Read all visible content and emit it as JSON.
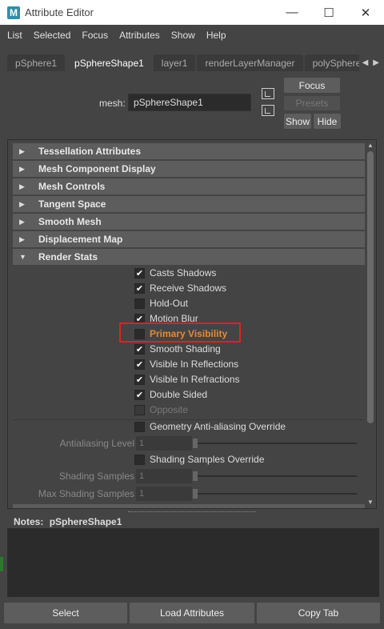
{
  "window": {
    "title": "Attribute Editor",
    "app_icon_letter": "M"
  },
  "window_controls": {
    "minimize": "—",
    "maximize": "☐",
    "close": "✕"
  },
  "menu": [
    "List",
    "Selected",
    "Focus",
    "Attributes",
    "Show",
    "Help"
  ],
  "tabs": [
    "pSphere1",
    "pSphereShape1",
    "layer1",
    "renderLayerManager",
    "polySphere"
  ],
  "active_tab": "pSphereShape1",
  "mesh": {
    "label": "mesh:",
    "value": "pSphereShape1"
  },
  "buttons": {
    "focus": "Focus",
    "presets": "Presets",
    "show": "Show",
    "hide": "Hide"
  },
  "sections": [
    {
      "label": "Tessellation Attributes",
      "expanded": false
    },
    {
      "label": "Mesh Component Display",
      "expanded": false
    },
    {
      "label": "Mesh Controls",
      "expanded": false
    },
    {
      "label": "Tangent Space",
      "expanded": false
    },
    {
      "label": "Smooth Mesh",
      "expanded": false
    },
    {
      "label": "Displacement Map",
      "expanded": false
    },
    {
      "label": "Render Stats",
      "expanded": true
    }
  ],
  "render_stats": [
    {
      "label": "Casts Shadows",
      "checked": true
    },
    {
      "label": "Receive Shadows",
      "checked": true
    },
    {
      "label": "Hold-Out",
      "checked": false
    },
    {
      "label": "Motion Blur",
      "checked": true
    },
    {
      "label": "Primary Visibility",
      "checked": false,
      "highlighted": true
    },
    {
      "label": "Smooth Shading",
      "checked": true
    },
    {
      "label": "Visible In Reflections",
      "checked": true
    },
    {
      "label": "Visible In Refractions",
      "checked": true
    },
    {
      "label": "Double Sided",
      "checked": true
    },
    {
      "label": "Opposite",
      "checked": false,
      "disabled": true
    }
  ],
  "overrides": {
    "geometry_aa": "Geometry Anti-aliasing Override",
    "antialiasing_level_label": "Antialiasing Level",
    "antialiasing_level_value": "1",
    "shading_samples_override": "Shading Samples Override",
    "shading_samples_label": "Shading Samples",
    "shading_samples_value": "1",
    "max_shading_samples_label": "Max Shading Samples",
    "max_shading_samples_value": "1"
  },
  "notes": {
    "label": "Notes:",
    "object": "pSphereShape1"
  },
  "bottom_buttons": {
    "select": "Select",
    "load": "Load Attributes",
    "copy": "Copy Tab"
  },
  "colors": {
    "highlight_box": "#e0211b",
    "highlight_text": "#e08a3c",
    "panel": "#444444",
    "section": "#5d5d5d"
  }
}
